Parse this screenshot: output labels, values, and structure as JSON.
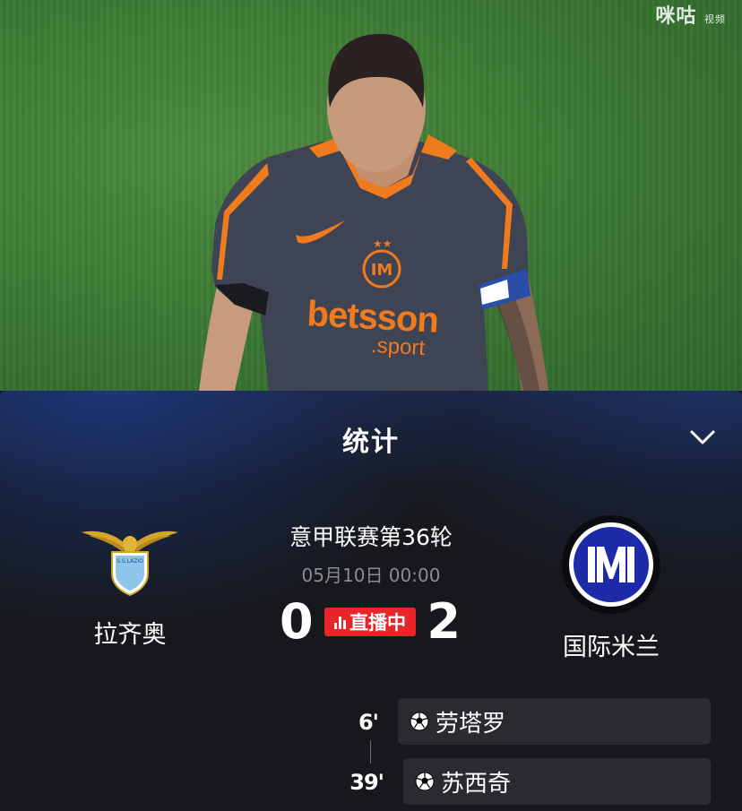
{
  "video": {
    "watermark": "咪咕",
    "watermark_small": "视频",
    "jersey_sponsor_line1": "betsson",
    "jersey_sponsor_line2": ".sport"
  },
  "panel": {
    "title": "统计",
    "collapse_icon": "chevron-down-icon"
  },
  "match": {
    "competition": "意甲联赛第36轮",
    "datetime": "05月10日 00:00",
    "live_label": "直播中",
    "home": {
      "name": "拉齐奥",
      "score": "0"
    },
    "away": {
      "name": "国际米兰",
      "score": "2"
    }
  },
  "goals": [
    {
      "minute": "6'",
      "player": "劳塔罗",
      "icon": "soccer-ball-icon"
    },
    {
      "minute": "39'",
      "player": "苏西奇",
      "icon": "soccer-ball-icon"
    }
  ],
  "colors": {
    "live_red": "#e8262a",
    "inter_blue": "#1e2ba8",
    "lazio_blue": "#8ec6ea",
    "lazio_gold": "#d4a62a",
    "card_bg": "#2a2b30"
  }
}
